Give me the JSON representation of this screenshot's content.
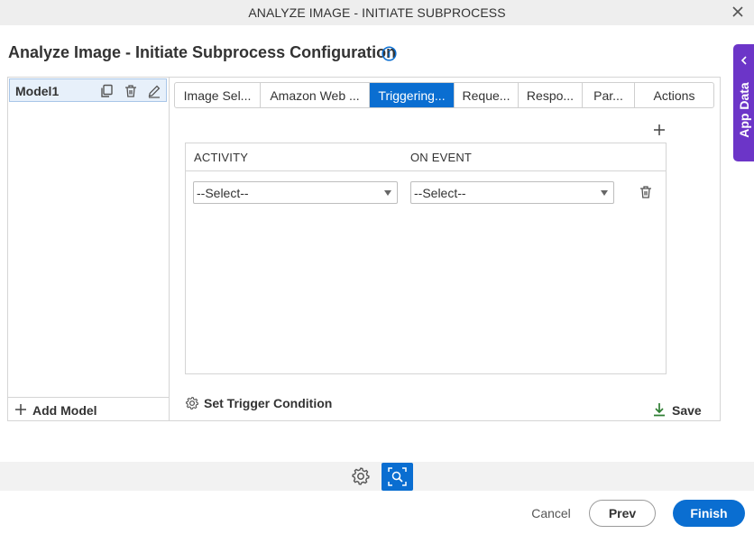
{
  "window": {
    "title": "ANALYZE IMAGE - INITIATE SUBPROCESS",
    "close_icon": "close-icon"
  },
  "page": {
    "title": "Analyze Image - Initiate Subprocess Configuration",
    "info_icon": "info-icon"
  },
  "app_data": {
    "label": "App Data",
    "color": "#6c35c8"
  },
  "models": {
    "items": [
      {
        "label": "Model1"
      }
    ],
    "add_label": "Add Model"
  },
  "tabs": [
    {
      "label": "Image Sel...",
      "active": false
    },
    {
      "label": "Amazon Web ...",
      "active": false
    },
    {
      "label": "Triggering...",
      "active": true
    },
    {
      "label": "Reque...",
      "active": false
    },
    {
      "label": "Respo...",
      "active": false
    },
    {
      "label": "Par...",
      "active": false
    },
    {
      "label": "Actions",
      "active": false
    }
  ],
  "grid": {
    "columns": [
      "ACTIVITY",
      "ON EVENT"
    ],
    "rows": [
      {
        "activity": "--Select--",
        "on_event": "--Select--"
      }
    ]
  },
  "actions": {
    "set_trigger_label": "Set Trigger Condition",
    "save_label": "Save"
  },
  "footer": {
    "cancel_label": "Cancel",
    "prev_label": "Prev",
    "finish_label": "Finish"
  },
  "colors": {
    "accent": "#0a6ed1",
    "save_green": "#2e7d32"
  }
}
